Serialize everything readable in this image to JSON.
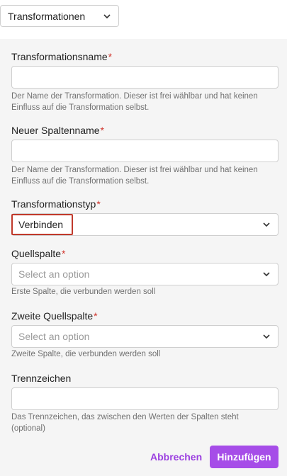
{
  "header": {
    "view_select_value": "Transformationen"
  },
  "form": {
    "name": {
      "label": "Transformationsname",
      "required_mark": "*",
      "value": "",
      "hint": "Der Name der Transformation. Dieser ist frei wählbar und hat keinen Einfluss auf die Transformation selbst."
    },
    "new_column": {
      "label": "Neuer Spaltenname",
      "required_mark": "*",
      "value": "",
      "hint": "Der Name der Transformation. Dieser ist frei wählbar und hat keinen Einfluss auf die Transformation selbst."
    },
    "type": {
      "label": "Transformationstyp",
      "required_mark": "*",
      "value": "Verbinden"
    },
    "source_column": {
      "label": "Quellspalte",
      "required_mark": "*",
      "placeholder": "Select an option",
      "hint": "Erste Spalte, die verbunden werden soll"
    },
    "second_source_column": {
      "label": "Zweite Quellspalte",
      "required_mark": "*",
      "placeholder": "Select an option",
      "hint": "Zweite Spalte, die verbunden werden soll"
    },
    "separator": {
      "label": "Trennzeichen",
      "value": "",
      "hint": "Das Trennzeichen, das zwischen den Werten der Spalten steht (optional)"
    }
  },
  "actions": {
    "cancel_label": "Abbrechen",
    "add_label": "Hinzufügen"
  },
  "colors": {
    "accent": "#a64de8",
    "required": "#d0342c",
    "highlight": "#c0392b"
  }
}
